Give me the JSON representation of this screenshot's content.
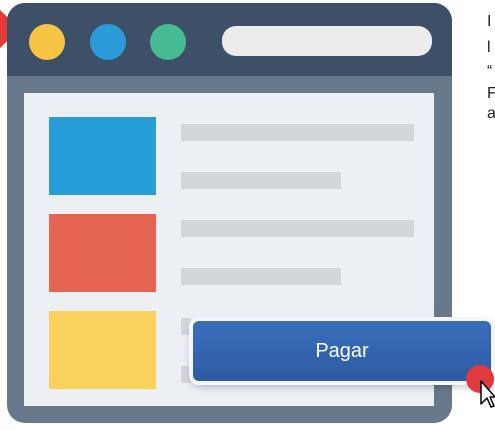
{
  "window": {
    "traffic_lights": [
      {
        "name": "close",
        "color": "#f7c443"
      },
      {
        "name": "minimize",
        "color": "#2a9ad8"
      },
      {
        "name": "maximize",
        "color": "#46bb94"
      }
    ]
  },
  "content": {
    "thumbnails": [
      {
        "color": "#279dd8"
      },
      {
        "color": "#e56452"
      },
      {
        "color": "#f9d15c"
      }
    ]
  },
  "pay_button": {
    "label": "Pagar"
  },
  "cropped_text": [
    "I",
    "l",
    "“",
    "F",
    "a"
  ],
  "colors": {
    "titlebar": "#3d5068",
    "frame": "#68798b",
    "content_bg": "#edf0f3",
    "placeholder_line": "#d3d6da",
    "button": "#2d5ba3",
    "cursor_dot": "#e03a3f",
    "pointer_arrow": "#e53935"
  }
}
